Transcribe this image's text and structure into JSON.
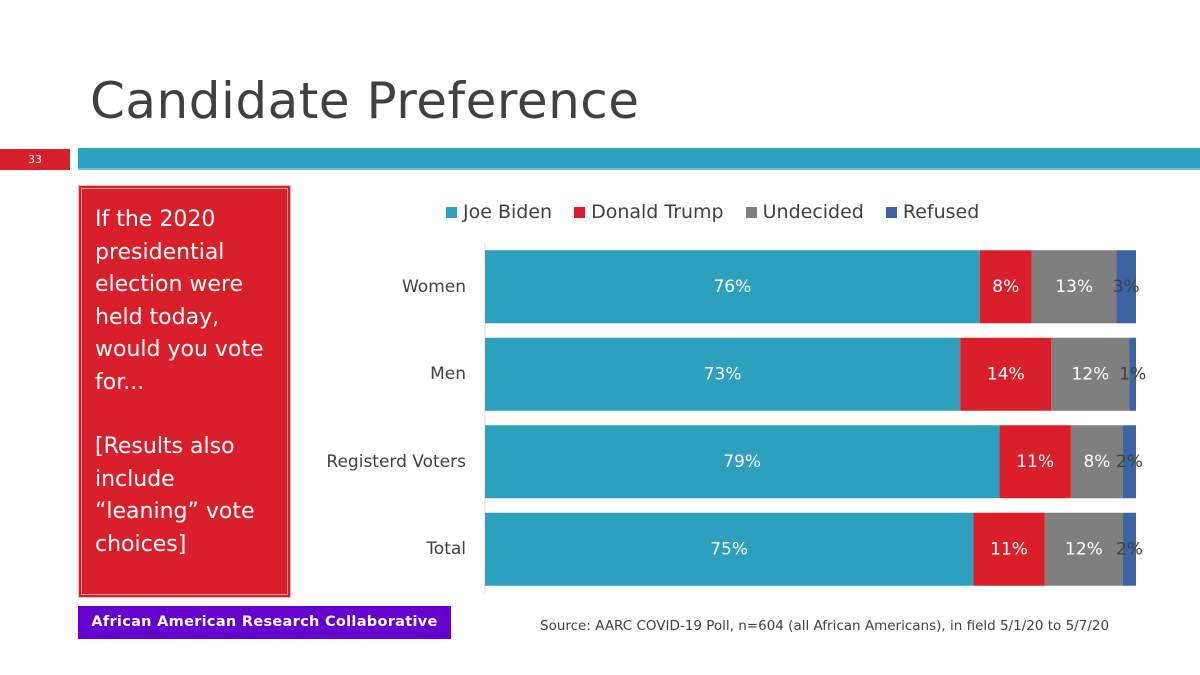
{
  "slide": {
    "title": "Candidate Preference",
    "number": "33",
    "question_paragraphs": [
      "If the 2020 presidential election were held today, would you vote for...",
      "[Results also include “leaning” vote choices]"
    ],
    "organization": "African American Research Collaborative",
    "source": "Source: AARC COVID-19 Poll, n=604 (all African Americans), in field 5/1/20 to 5/7/20"
  },
  "colors": {
    "accent_red": "#d9202a",
    "accent_teal": "#2ca0bd",
    "org_purple": "#6600cc"
  },
  "chart_data": {
    "type": "bar",
    "orientation": "horizontal",
    "stacked": true,
    "percent_stacked": true,
    "title": "",
    "xlabel": "",
    "ylabel": "",
    "xlim": [
      0,
      100
    ],
    "grid": false,
    "legend_position": "top",
    "categories": [
      "Women",
      "Men",
      "Registerd Voters",
      "Total"
    ],
    "series": [
      {
        "name": "Joe Biden",
        "color": "#2ca0bd",
        "label_color": "#ffffff",
        "values": [
          76,
          73,
          79,
          75
        ]
      },
      {
        "name": "Donald Trump",
        "color": "#d9202a",
        "label_color": "#ffffff",
        "values": [
          8,
          14,
          11,
          11
        ]
      },
      {
        "name": "Undecided",
        "color": "#7f7f7f",
        "label_color": "#ffffff",
        "values": [
          13,
          12,
          8,
          12
        ]
      },
      {
        "name": "Refused",
        "color": "#3a64a3",
        "label_color": "#404040",
        "values": [
          3,
          1,
          2,
          2
        ]
      }
    ],
    "value_format": "{v}%"
  }
}
